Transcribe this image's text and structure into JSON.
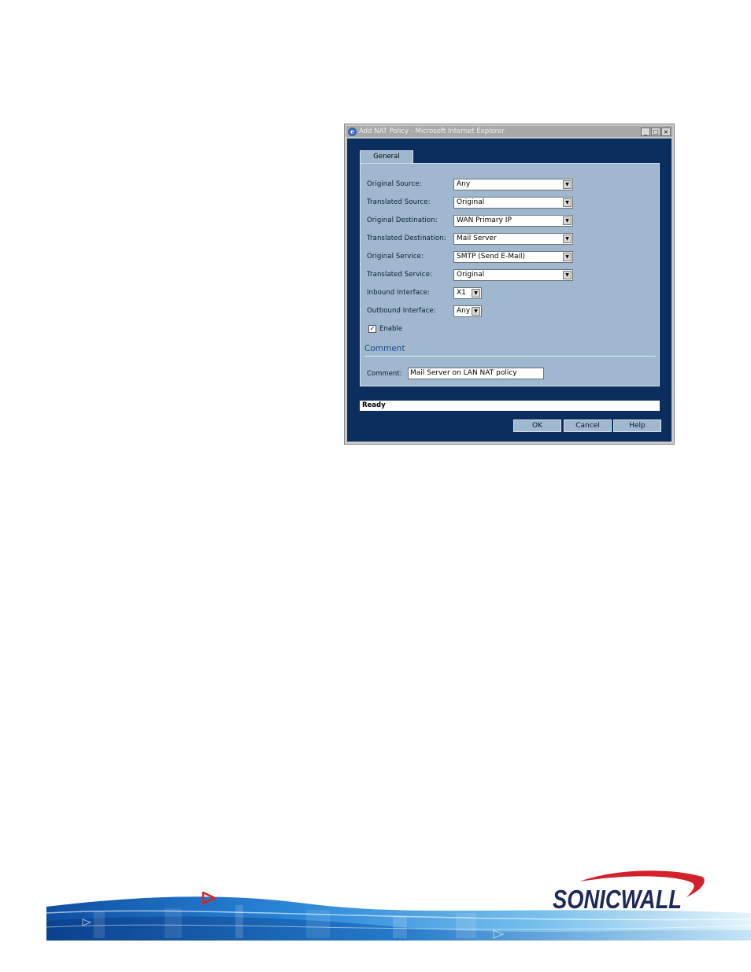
{
  "window": {
    "title": "Add NAT Policy - Microsoft Internet Explorer",
    "minimize": "_",
    "maximize": "□",
    "close": "×"
  },
  "tab": {
    "label": "General"
  },
  "fields": [
    {
      "label": "Original Source:",
      "value": "Any"
    },
    {
      "label": "Translated Source:",
      "value": "Original"
    },
    {
      "label": "Original Destination:",
      "value": "WAN Primary IP"
    },
    {
      "label": "Translated Destination:",
      "value": "Mail Server"
    },
    {
      "label": "Original Service:",
      "value": "SMTP (Send E-Mail)"
    },
    {
      "label": "Translated Service:",
      "value": "Original"
    },
    {
      "label": "Inbound Interface:",
      "value": "X1"
    },
    {
      "label": "Outbound Interface:",
      "value": "Any"
    }
  ],
  "enable": {
    "label": "Enable",
    "checked": true,
    "mark": "✓"
  },
  "comment_section": {
    "title": "Comment",
    "label": "Comment:",
    "value": "Mail Server on LAN NAT policy"
  },
  "status": "Ready",
  "buttons": {
    "ok": "OK",
    "cancel": "Cancel",
    "help": "Help"
  },
  "brand": {
    "name": "SONICWALL"
  },
  "icons": [
    "ie-icon",
    "dropdown-arrow-icon",
    "checkbox-check-icon",
    "play-arrow-icon"
  ],
  "colors": {
    "dialog_bg": "#0b2e5e",
    "panel_bg": "#9fb8cf",
    "section_title": "#1b4b8c",
    "brand_red": "#d4202a",
    "brand_navy": "#1d2a5c"
  }
}
